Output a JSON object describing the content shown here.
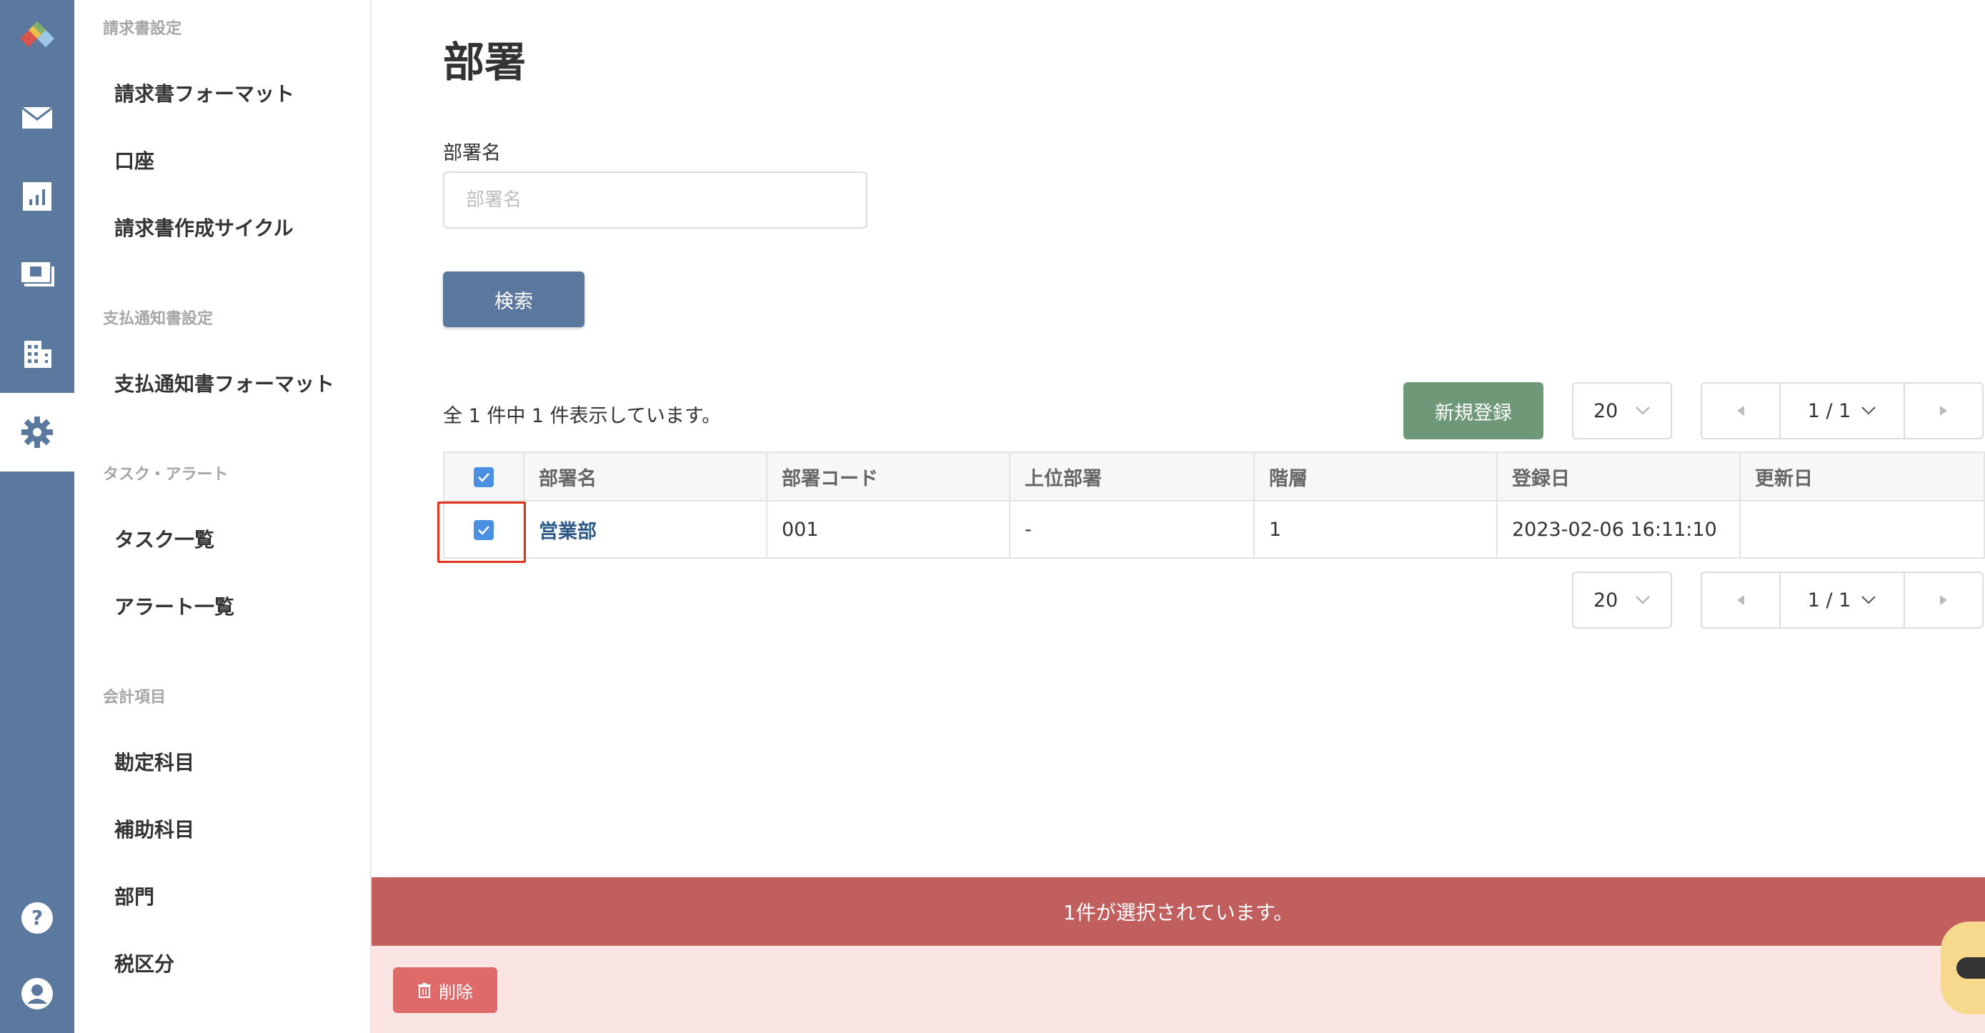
{
  "colors": {
    "rail": "#5b789e",
    "primary_button": "#5b789e",
    "new_button": "#6e9877",
    "selection_bar": "#c15e5e",
    "selection_area": "#fbe4e4",
    "delete_button": "#df6a6a",
    "checkbox": "#4a90e2",
    "highlight": "#e0341c"
  },
  "rail": {
    "items": [
      {
        "icon": "app-logo-icon"
      },
      {
        "icon": "mail-icon"
      },
      {
        "icon": "chart-icon"
      },
      {
        "icon": "payment-icon"
      },
      {
        "icon": "building-icon"
      },
      {
        "icon": "gear-icon",
        "active": true
      },
      {
        "icon": "help-icon"
      },
      {
        "icon": "account-icon"
      }
    ]
  },
  "subnav": {
    "sections": [
      {
        "heading": "請求書設定",
        "items": [
          "請求書フォーマット",
          "口座",
          "請求書作成サイクル"
        ]
      },
      {
        "heading": "支払通知書設定",
        "items": [
          "支払通知書フォーマット"
        ]
      },
      {
        "heading": "タスク・アラート",
        "items": [
          "タスク一覧",
          "アラート一覧"
        ]
      },
      {
        "heading": "会計項目",
        "items": [
          "勘定科目",
          "補助科目",
          "部門",
          "税区分"
        ]
      }
    ]
  },
  "page": {
    "title": "部署",
    "filter_label": "部署名",
    "filter_placeholder": "部署名",
    "search_button": "検索",
    "count_text": "全 1 件中 1 件表示しています。",
    "new_button": "新規登録",
    "per_page": "20",
    "pagination": "1 / 1"
  },
  "table": {
    "columns": [
      "部署名",
      "部署コード",
      "上位部署",
      "階層",
      "登録日",
      "更新日"
    ],
    "header_checked": true,
    "rows": [
      {
        "checked": true,
        "name": "営業部",
        "code": "001",
        "parent": "-",
        "level": "1",
        "created": "2023-02-06 16:11:10",
        "updated": ""
      }
    ]
  },
  "selection": {
    "message": "1件が選択されています。",
    "delete_button": "削除"
  }
}
